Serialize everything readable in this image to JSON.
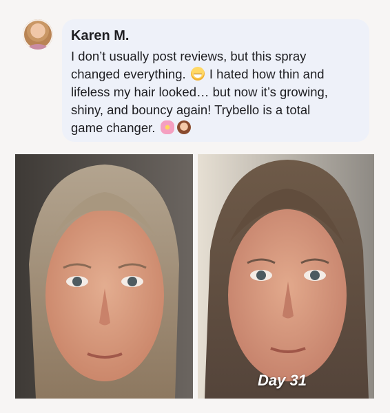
{
  "review": {
    "author": "Karen M.",
    "line1": "I don’t usually post reviews, but this spray",
    "line2a": "changed everything.",
    "line2b": "I hated how thin and",
    "line3": "lifeless my hair looked… but now it’s growing,",
    "line4": "shiny, and bouncy again! Trybello is a total",
    "line5": "game changer."
  },
  "icons": {
    "emoji_1": "grinning-face-emoji",
    "emoji_2": "flower-emoji",
    "emoji_3": "woman-emoji"
  },
  "photos": {
    "after_label": "Day 31"
  },
  "colors": {
    "bubble": "#eef1f9",
    "background": "#f7f5f4",
    "text": "#1e1e22"
  }
}
